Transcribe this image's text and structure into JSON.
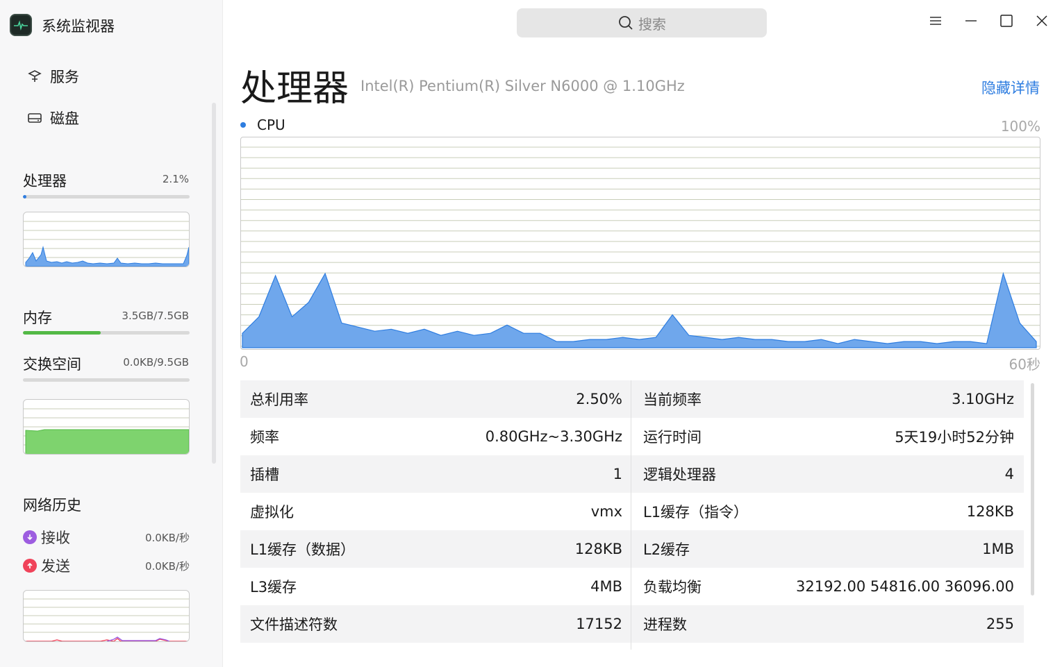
{
  "app": {
    "title": "系统监视器"
  },
  "nav": {
    "services": "服务",
    "disk": "磁盘"
  },
  "sidebar": {
    "cpu": {
      "label": "处理器",
      "value": "2.1%",
      "usage_fraction": 0.021
    },
    "memory": {
      "label": "内存",
      "value": "3.5GB/7.5GB",
      "usage_fraction": 0.467
    },
    "swap": {
      "label": "交换空间",
      "value": "0.0KB/9.5GB",
      "usage_fraction": 0.0
    },
    "network": {
      "label": "网络历史",
      "receive_label": "接收",
      "receive_value": "0.0KB/秒",
      "send_label": "发送",
      "send_value": "0.0KB/秒"
    }
  },
  "search": {
    "placeholder": "搜索"
  },
  "main": {
    "title": "处理器",
    "cpu_model": "Intel(R) Pentium(R) Silver N6000 @ 1.10GHz",
    "hide_details": "隐藏详情",
    "legend": "CPU",
    "y_max_label": "100%",
    "x_min_label": "0",
    "x_max_label": "60秒"
  },
  "chart_data": {
    "type": "area",
    "series": [
      {
        "name": "CPU",
        "values": [
          7,
          15,
          35,
          15,
          22,
          36,
          12,
          10,
          8,
          9,
          7,
          9,
          6,
          8,
          6,
          7,
          11,
          7,
          7,
          3,
          3,
          4,
          4,
          5,
          4,
          5,
          16,
          6,
          5,
          4,
          5,
          4,
          4,
          3,
          3,
          4,
          2,
          4,
          3,
          2,
          3,
          3,
          2,
          3,
          3,
          2,
          36,
          12,
          3
        ]
      }
    ],
    "ylim": [
      0,
      100
    ],
    "xlim": [
      0,
      60
    ],
    "grid": true,
    "color": "#2e7de0"
  },
  "details": [
    [
      "总利用率",
      "2.50%",
      "当前频率",
      "3.10GHz"
    ],
    [
      "频率",
      "0.80GHz~3.30GHz",
      "运行时间",
      "5天19小时52分钟"
    ],
    [
      "插槽",
      "1",
      "逻辑处理器",
      "4"
    ],
    [
      "虚拟化",
      "vmx",
      "L1缓存（指令）",
      "128KB"
    ],
    [
      "L1缓存（数据）",
      "128KB",
      "L2缓存",
      "1MB"
    ],
    [
      "L3缓存",
      "4MB",
      "负载均衡",
      "32192.00 54816.00 36096.00"
    ],
    [
      "文件描述符数",
      "17152",
      "进程数",
      "255"
    ]
  ],
  "colors": {
    "accent": "#2e7de0",
    "memory": "#53b946",
    "receive": "#9d5de0",
    "send": "#f0435a"
  }
}
